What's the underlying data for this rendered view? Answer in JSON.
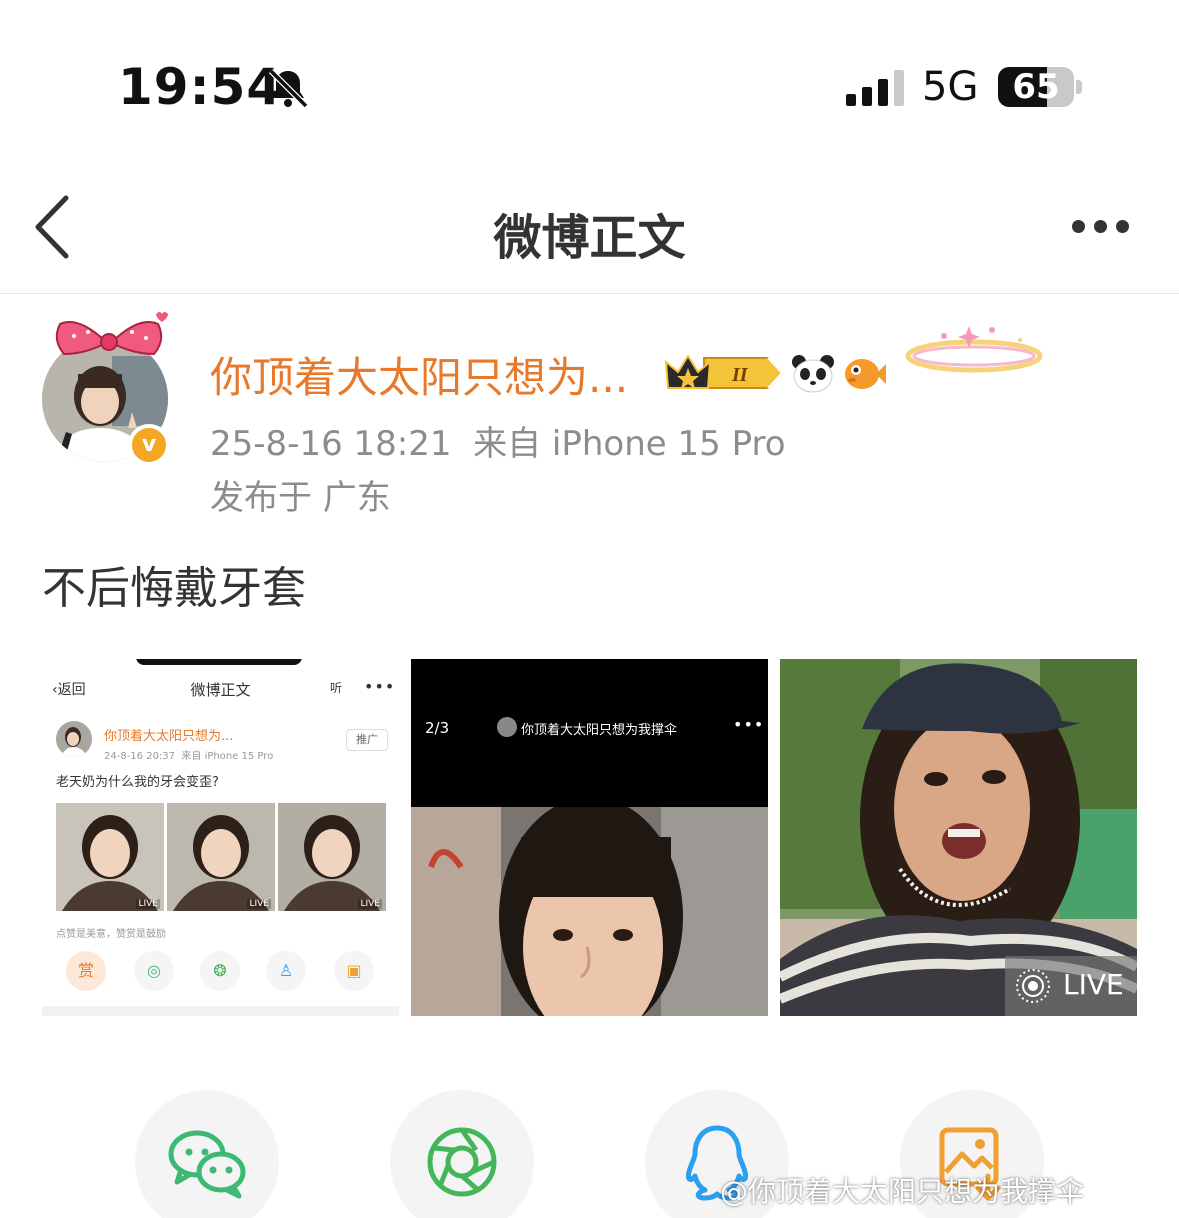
{
  "status_bar": {
    "time": "19:54",
    "network": "5G",
    "battery": "65",
    "battery_level_percent": 65,
    "icons": [
      "bell-slash-icon",
      "signal-icon",
      "battery-icon"
    ]
  },
  "nav": {
    "title": "微博正文",
    "icons": [
      "chevron-left-icon",
      "more-icon"
    ]
  },
  "post": {
    "author_name": "你顶着大太阳只想为...",
    "level_badge": "II",
    "timestamp": "25-8-16 18:21",
    "source": "来自 iPhone 15 Pro",
    "location": "发布于 广东",
    "text": "不后悔戴牙套"
  },
  "images": {
    "mini": {
      "back": "返回",
      "title": "微博正文",
      "listen": "听",
      "more": "•••",
      "author_name": "你顶着大太阳只想为...",
      "timestamp": "24-8-16 20:37",
      "source": "来自 iPhone 15 Pro",
      "promo": "推广",
      "text": "老天奶为什么我的牙会变歪?",
      "live": "LIVE",
      "reward_line": "点赞是美意，赞赏是鼓励",
      "reward": "赏"
    },
    "dark": {
      "counter": "2/3",
      "title": "你顶着大太阳只想为我撑伞",
      "more": "•••"
    },
    "third": {
      "live": "LIVE"
    }
  },
  "share": {
    "icons": [
      "wechat-icon",
      "moments-icon",
      "qq-icon",
      "save-image-icon"
    ]
  },
  "watermark": "@你顶着大太阳只想为我撑伞",
  "colors": {
    "author": "#e8792a",
    "verified": "#f5a623",
    "wechat": "#3cba75",
    "moments": "#45b55a",
    "qq": "#2b9ff0",
    "save": "#f0a030"
  }
}
